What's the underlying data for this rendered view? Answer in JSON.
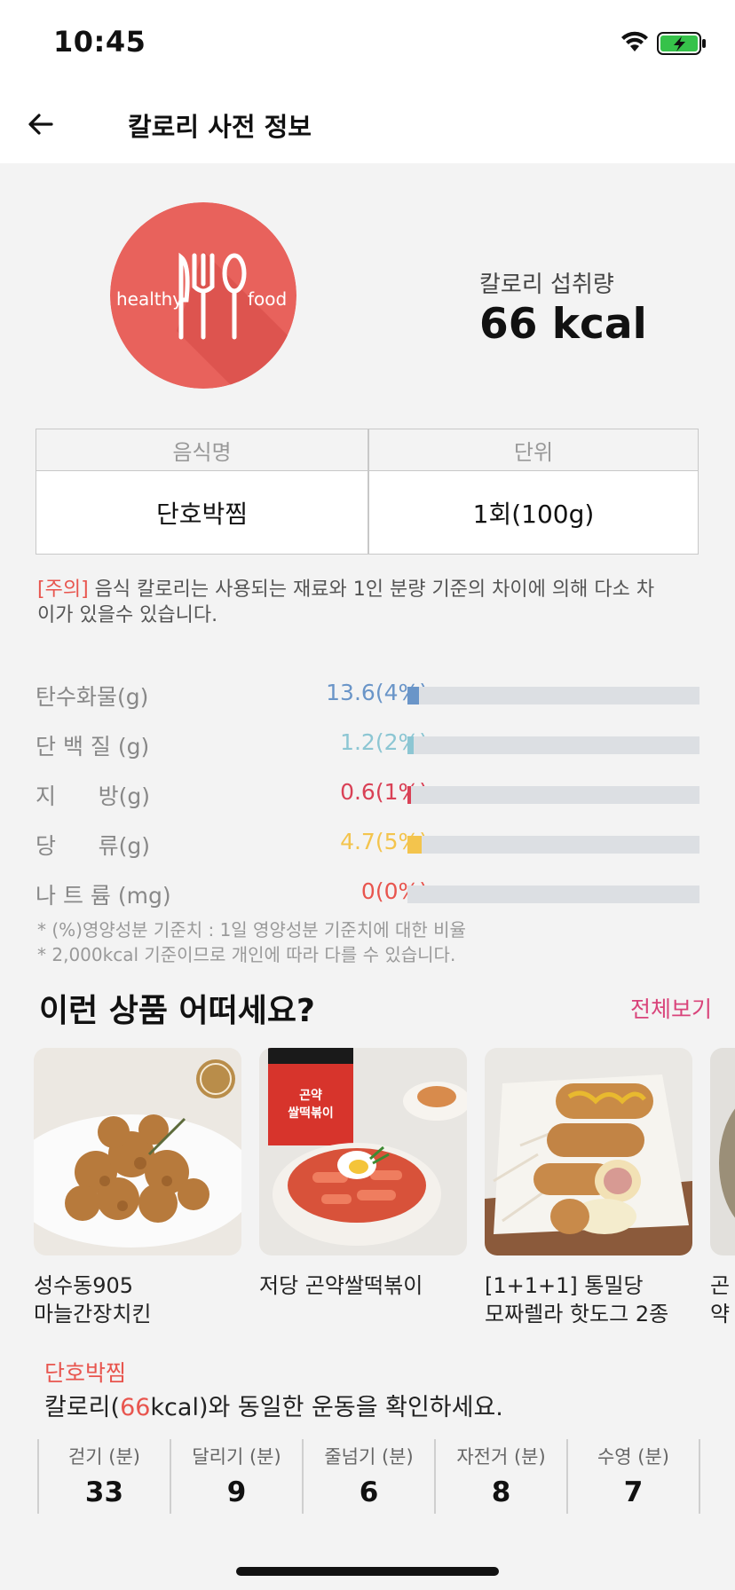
{
  "status_bar": {
    "time": "10:45"
  },
  "header": {
    "title": "칼로리 사전 정보"
  },
  "summary": {
    "logo_text_left": "healthy",
    "logo_text_right": "food",
    "intake_label": "칼로리 섭취량",
    "intake_value": "66 kcal"
  },
  "info_table": {
    "headers": [
      "음식명",
      "단위"
    ],
    "values": [
      "단호박찜",
      "1회(100g)"
    ]
  },
  "notice": {
    "tag": "[주의]",
    "text": " 음식 칼로리는 사용되는 재료와 1인 분량 기준의 차이에 의해 다소 차이가 있을수 있습니다."
  },
  "nutrients": [
    {
      "label": "탄수화물(g)",
      "value": "13.6(4%)",
      "percent": 4,
      "color": "#6a95c8"
    },
    {
      "label": "단 백 질 (g)",
      "value": "1.2(2%)",
      "percent": 2,
      "color": "#8cc6d3"
    },
    {
      "label": "지      방(g)",
      "value": "0.6(1%)",
      "percent": 1,
      "color": "#d94156"
    },
    {
      "label": "당      류(g)",
      "value": "4.7(5%)",
      "percent": 5,
      "color": "#f3c44d"
    },
    {
      "label": "나 트 륨 (mg)",
      "value": "0(0%)",
      "percent": 0,
      "color": "#e8554e"
    }
  ],
  "footnotes": [
    "* (%)영양성분 기준치 : 1일 영양성분 기준치에 대한 비율",
    "* 2,000kcal 기준이므로 개인에 따라 다를 수 있습니다."
  ],
  "recommend": {
    "title": "이런 상품 어떠세요?",
    "view_all": "전체보기",
    "products": [
      {
        "name": "성수동905\n마늘간장치킨"
      },
      {
        "name": "저당 곤약쌀떡볶이"
      },
      {
        "name": "[1+1+1] 통밀당\n모짜렐라 핫도그 2종"
      },
      {
        "name": "곤약"
      }
    ]
  },
  "exercise": {
    "food": "단호박찜",
    "text_prefix": "칼로리(",
    "kcal": "66",
    "text_suffix": "kcal)와 동일한 운동을 확인하세요.",
    "items": [
      {
        "label": "걷기 (분)",
        "value": "33"
      },
      {
        "label": "달리기 (분)",
        "value": "9"
      },
      {
        "label": "줄넘기 (분)",
        "value": "6"
      },
      {
        "label": "자전거 (분)",
        "value": "8"
      },
      {
        "label": "수영 (분)",
        "value": "7"
      }
    ]
  },
  "colors": {
    "accent_red": "#e8554e",
    "view_all_pink": "#d9437a"
  }
}
